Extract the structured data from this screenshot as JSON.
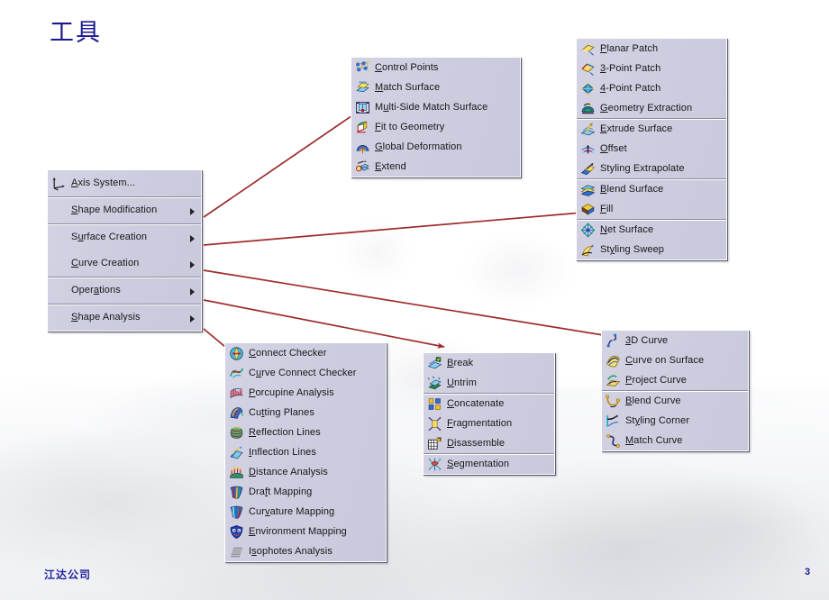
{
  "slide": {
    "title": "工具",
    "footer_company": "江达公司",
    "page_number": "3",
    "accent_color": "#1a1a8c",
    "arrow_color": "#9e2b2b",
    "menu_face_color": "#cdcddf"
  },
  "menus": {
    "root": {
      "name": "Shape Design root menu",
      "groups": [
        {
          "items": [
            {
              "label": "Axis System...",
              "accel": "A",
              "icon": "axis-system-icon",
              "submenu": false
            }
          ]
        },
        {
          "items": [
            {
              "label": "Shape Modification",
              "accel": "S",
              "icon": "none",
              "submenu": true
            }
          ]
        },
        {
          "items": [
            {
              "label": "Surface Creation",
              "accel": "u",
              "icon": "none",
              "submenu": true
            },
            {
              "label": "Curve Creation",
              "accel": "C",
              "icon": "none",
              "submenu": true
            }
          ]
        },
        {
          "items": [
            {
              "label": "Operations",
              "accel": "a",
              "icon": "none",
              "submenu": true
            }
          ]
        },
        {
          "items": [
            {
              "label": "Shape Analysis",
              "accel": "S",
              "icon": "none",
              "submenu": true
            }
          ]
        }
      ]
    },
    "shape_modification": {
      "name": "Shape Modification submenu",
      "groups": [
        {
          "items": [
            {
              "label": "Control Points",
              "accel": "C",
              "icon": "control-points-icon"
            },
            {
              "label": "Match Surface",
              "accel": "M",
              "icon": "match-surface-icon"
            },
            {
              "label": "Multi-Side Match Surface",
              "accel": "u",
              "icon": "multi-side-match-surface-icon"
            },
            {
              "label": "Fit to Geometry",
              "accel": "F",
              "icon": "fit-to-geometry-icon"
            },
            {
              "label": "Global Deformation",
              "accel": "G",
              "icon": "global-deformation-icon"
            },
            {
              "label": "Extend",
              "accel": "E",
              "icon": "extend-icon"
            }
          ]
        }
      ]
    },
    "surface_creation": {
      "name": "Surface Creation submenu",
      "groups": [
        {
          "items": [
            {
              "label": "Planar Patch",
              "accel": "P",
              "icon": "planar-patch-icon"
            },
            {
              "label": "3-Point Patch",
              "accel": "3",
              "icon": "three-point-patch-icon"
            },
            {
              "label": "4-Point Patch",
              "accel": "4",
              "icon": "four-point-patch-icon"
            },
            {
              "label": "Geometry Extraction",
              "accel": "G",
              "icon": "geometry-extraction-icon"
            }
          ]
        },
        {
          "items": [
            {
              "label": "Extrude Surface",
              "accel": "E",
              "icon": "extrude-surface-icon"
            },
            {
              "label": "Offset",
              "accel": "O",
              "icon": "offset-icon"
            },
            {
              "label": "Styling Extrapolate",
              "accel": "g",
              "icon": "styling-extrapolate-icon"
            }
          ]
        },
        {
          "items": [
            {
              "label": "Blend Surface",
              "accel": "B",
              "icon": "blend-surface-icon"
            },
            {
              "label": "Fill",
              "accel": "F",
              "icon": "fill-icon"
            }
          ]
        },
        {
          "items": [
            {
              "label": "Net Surface",
              "accel": "N",
              "icon": "net-surface-icon"
            },
            {
              "label": "Styling Sweep",
              "accel": "y",
              "icon": "styling-sweep-icon"
            }
          ]
        }
      ]
    },
    "curve_creation": {
      "name": "Curve Creation submenu",
      "groups": [
        {
          "items": [
            {
              "label": "3D Curve",
              "accel": "3",
              "icon": "three-d-curve-icon"
            },
            {
              "label": "Curve on Surface",
              "accel": "C",
              "icon": "curve-on-surface-icon"
            },
            {
              "label": "Project Curve",
              "accel": "P",
              "icon": "project-curve-icon"
            }
          ]
        },
        {
          "items": [
            {
              "label": "Blend Curve",
              "accel": "B",
              "icon": "blend-curve-icon"
            },
            {
              "label": "Styling Corner",
              "accel": "y",
              "icon": "styling-corner-icon"
            },
            {
              "label": "Match Curve",
              "accel": "M",
              "icon": "match-curve-icon"
            }
          ]
        }
      ]
    },
    "operations": {
      "name": "Operations submenu",
      "groups": [
        {
          "items": [
            {
              "label": "Break",
              "accel": "B",
              "icon": "break-icon"
            },
            {
              "label": "Untrim",
              "accel": "U",
              "icon": "untrim-icon"
            }
          ]
        },
        {
          "items": [
            {
              "label": "Concatenate",
              "accel": "C",
              "icon": "concatenate-icon"
            },
            {
              "label": "Fragmentation",
              "accel": "F",
              "icon": "fragmentation-icon"
            },
            {
              "label": "Disassemble",
              "accel": "D",
              "icon": "disassemble-icon"
            }
          ]
        },
        {
          "items": [
            {
              "label": "Segmentation",
              "accel": "S",
              "icon": "segmentation-icon"
            }
          ]
        }
      ]
    },
    "shape_analysis": {
      "name": "Shape Analysis submenu",
      "groups": [
        {
          "items": [
            {
              "label": "Connect Checker",
              "accel": "C",
              "icon": "connect-checker-icon"
            },
            {
              "label": "Curve Connect Checker",
              "accel": "u",
              "icon": "curve-connect-checker-icon"
            },
            {
              "label": "Porcupine Analysis",
              "accel": "P",
              "icon": "porcupine-analysis-icon"
            },
            {
              "label": "Cutting Planes",
              "accel": "t",
              "icon": "cutting-planes-icon"
            },
            {
              "label": "Reflection Lines",
              "accel": "R",
              "icon": "reflection-lines-icon"
            },
            {
              "label": "Inflection Lines",
              "accel": "I",
              "icon": "inflection-lines-icon"
            },
            {
              "label": "Distance Analysis",
              "accel": "D",
              "icon": "distance-analysis-icon"
            },
            {
              "label": "Draft Mapping",
              "accel": "f",
              "icon": "draft-mapping-icon"
            },
            {
              "label": "Curvature Mapping",
              "accel": "v",
              "icon": "curvature-mapping-icon"
            },
            {
              "label": "Environment Mapping",
              "accel": "E",
              "icon": "environment-mapping-icon"
            },
            {
              "label": "Isophotes Analysis",
              "accel": "s",
              "icon": "isophotes-analysis-icon"
            }
          ]
        }
      ]
    }
  },
  "connectors": [
    {
      "from": "Shape Modification",
      "to": "Shape Modification submenu"
    },
    {
      "from": "Surface Creation",
      "to": "Surface Creation submenu"
    },
    {
      "from": "Curve Creation",
      "to": "Curve Creation submenu"
    },
    {
      "from": "Operations",
      "to": "Operations submenu"
    },
    {
      "from": "Shape Analysis",
      "to": "Shape Analysis submenu"
    }
  ]
}
